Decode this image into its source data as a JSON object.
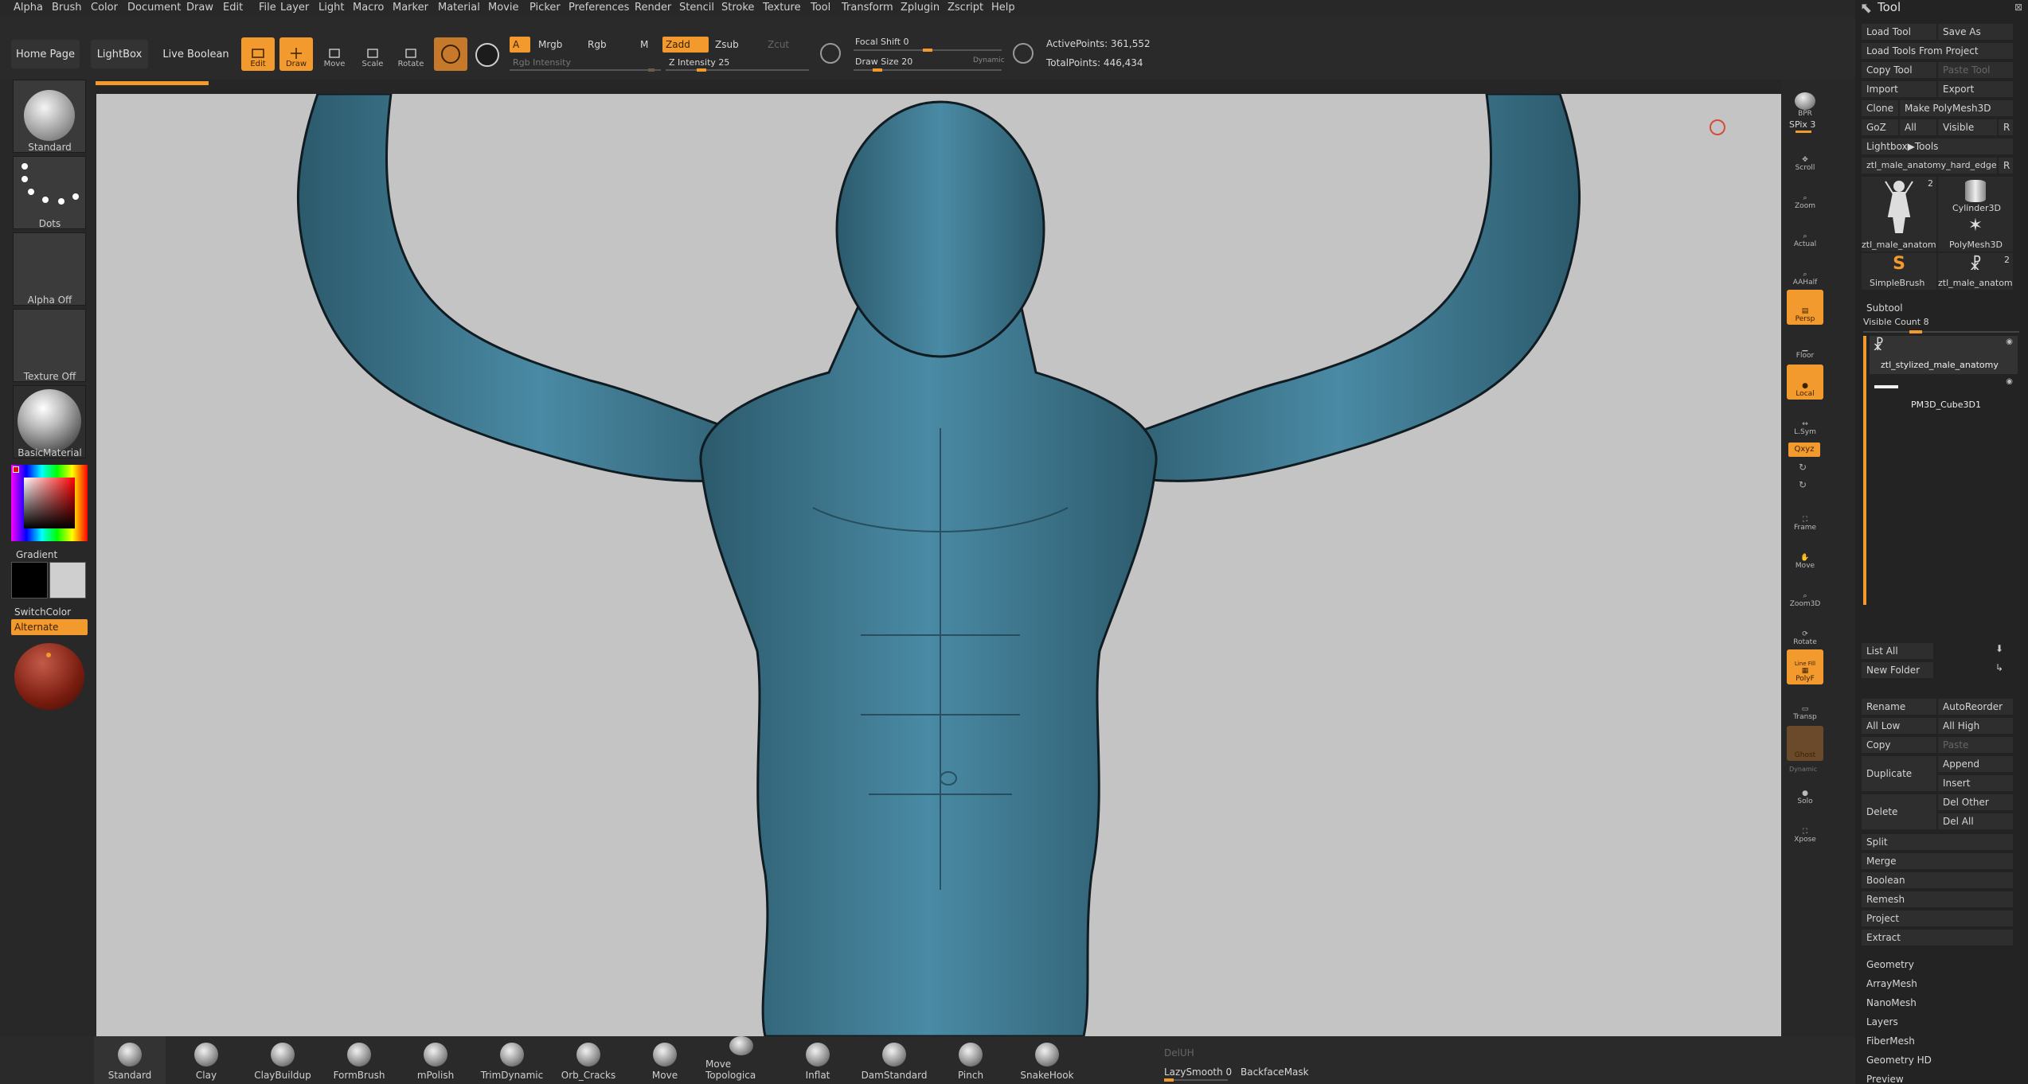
{
  "menu": [
    "Alpha",
    "Brush",
    "Color",
    "Document",
    "Draw",
    "Edit",
    "File",
    "Layer",
    "Light",
    "Macro",
    "Marker",
    "Material",
    "Movie",
    "Picker",
    "Preferences",
    "Render",
    "Stencil",
    "Stroke",
    "Texture",
    "Tool",
    "Transform",
    "Zplugin",
    "Zscript",
    "Help"
  ],
  "top": {
    "home_page": "Home Page",
    "lightbox": "LightBox",
    "live_boolean": "Live Boolean",
    "edit": "Edit",
    "draw": "Draw",
    "move": "Move",
    "scale": "Scale",
    "rotate": "Rotate",
    "a": "A",
    "mrgb": "Mrgb",
    "rgb": "Rgb",
    "m": "M",
    "zadd": "Zadd",
    "zsub": "Zsub",
    "zcut": "Zcut",
    "rgb_intensity": "Rgb Intensity",
    "z_intensity": "Z Intensity 25",
    "focal_shift": "Focal Shift 0",
    "draw_size": "Draw Size 20",
    "dynamic": "Dynamic",
    "active_points": "ActivePoints: 361,552",
    "total_points": "TotalPoints: 446,434",
    "z_intensity_level": 0.25,
    "focal_level": 0.5,
    "draw_size_level": 0.16
  },
  "left": {
    "brush": "Standard",
    "stroke": "Dots",
    "alpha": "Alpha Off",
    "texture": "Texture Off",
    "material": "BasicMaterial",
    "gradient": "Gradient",
    "switch_color": "SwitchColor",
    "alternate": "Alternate"
  },
  "right": {
    "bpr": "BPR",
    "spix": "SPix 3",
    "scroll": "Scroll",
    "zoom": "Zoom",
    "actual": "Actual",
    "aahalf": "AAHalf",
    "persp": "Persp",
    "floor": "Floor",
    "local": "Local",
    "lsym": "L.Sym",
    "xyz": "Qxyz",
    "frame": "Frame",
    "move": "Move",
    "zoom3d": "Zoom3D",
    "rotate": "Rotate",
    "polyf": "PolyF",
    "transp": "Transp",
    "ghost": "Ghost",
    "dynamic": "Dynamic",
    "solo": "Solo",
    "xpose": "Xpose",
    "line_fill": "Line Fill"
  },
  "tool": {
    "title": "Tool",
    "load_tool": "Load Tool",
    "save_as": "Save As",
    "load_from_project": "Load Tools From Project",
    "copy_tool": "Copy Tool",
    "paste_tool": "Paste Tool",
    "import": "Import",
    "export": "Export",
    "clone": "Clone",
    "make_polymesh": "Make PolyMesh3D",
    "goz": "GoZ",
    "all": "All",
    "visible": "Visible",
    "r": "R",
    "lightbox_tools": "Lightbox▶Tools",
    "current_tool": "ztl_male_anatomy_hard_edge",
    "thumbs": [
      {
        "label": "ztl_male_anatom",
        "count": "2"
      },
      {
        "label": "Cylinder3D",
        "count": ""
      },
      {
        "label": "PolyMesh3D",
        "count": ""
      },
      {
        "label": "SimpleBrush",
        "count": ""
      },
      {
        "label": "ztl_male_anatom",
        "count": "2"
      }
    ],
    "subtool": "Subtool",
    "visible_count": "Visible Count 8",
    "subtools": [
      "ztl_stylized_male_anatomy",
      "PM3D_Cube3D1"
    ],
    "list_all": "List All",
    "new_folder": "New Folder",
    "rename": "Rename",
    "autoreorder": "AutoReorder",
    "all_low": "All Low",
    "all_high": "All High",
    "copy": "Copy",
    "paste": "Paste",
    "duplicate": "Duplicate",
    "append": "Append",
    "insert": "Insert",
    "delete": "Delete",
    "del_other": "Del Other",
    "del_all": "Del All",
    "actions": [
      "Split",
      "Merge",
      "Boolean",
      "Remesh",
      "Project",
      "Extract"
    ],
    "sections": [
      "Geometry",
      "ArrayMesh",
      "NanoMesh",
      "Layers",
      "FiberMesh",
      "Geometry HD",
      "Preview"
    ]
  },
  "brushes": [
    "Standard",
    "Clay",
    "ClayBuildup",
    "FormBrush",
    "mPolish",
    "TrimDynamic",
    "Orb_Cracks",
    "Move",
    "Move Topologica",
    "Inflat",
    "DamStandard",
    "Pinch",
    "SnakeHook"
  ],
  "bottom": {
    "deluh": "DelUH",
    "lazy": "LazySmooth 0",
    "backface": "BackfaceMask"
  },
  "colors": {
    "accent": "#f39a2e",
    "mesh": "#3f7f99",
    "canvas": "#c4c4c4"
  }
}
